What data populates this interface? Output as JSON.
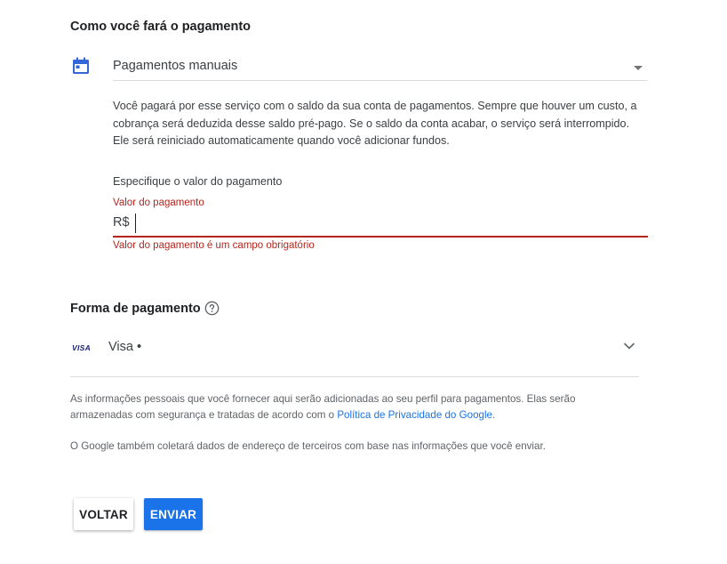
{
  "payment_section": {
    "title": "Como você fará o pagamento",
    "method_select": {
      "icon": "calendar-icon",
      "value": "Pagamentos manuais"
    },
    "description": "Você pagará por esse serviço com o saldo da sua conta de pagamentos. Sempre que houver um custo, a cobrança será deduzida desse saldo pré-pago. Se o saldo da conta acabar, o serviço será interrompido. Ele será reiniciado automaticamente quando você adicionar fundos.",
    "amount": {
      "section_label": "Especifique o valor do pagamento",
      "field_label": "Valor do pagamento",
      "currency": "R$",
      "value": "",
      "error": "Valor do pagamento é um campo obrigatório"
    }
  },
  "payment_method_section": {
    "title": "Forma de pagamento",
    "help_icon": "help-circle-icon",
    "selected": {
      "logo": "VISA",
      "label": "Visa •"
    }
  },
  "info": {
    "text_before_link": "As informações pessoais que você fornecer aqui serão adicionadas ao seu perfil para pagamentos. Elas serão armazenadas com segurança e tratadas de acordo com o ",
    "link": "Política de Privacidade do Google",
    "text_after_link": ".",
    "third_party": "O Google também coletará dados de endereço de terceiros com base nas informações que você enviar."
  },
  "buttons": {
    "back": "VOLTAR",
    "send": "ENVIAR"
  },
  "colors": {
    "primary": "#1a73e8",
    "error": "#b3261e",
    "icon": "#3367d6"
  }
}
